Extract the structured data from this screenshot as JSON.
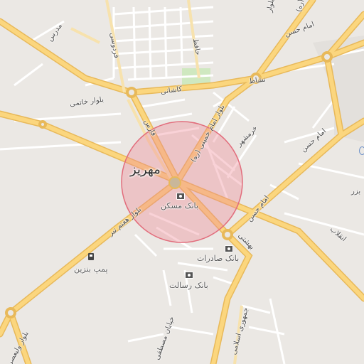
{
  "map": {
    "city_label": "مهریز",
    "roads": {
      "modarres": "مدرس",
      "ferdowsi": "فردوسی",
      "hafez": "حافظ",
      "blvd_khatami": "بلوار خاتمی",
      "kashani": "کاشانی",
      "nashat": "نشاط",
      "blvd_imam_khomeini": "بلوار امام خمینی (ره)",
      "fars": "فارس",
      "imam_hasan_top": "امام حسن",
      "imam_hasan_right": "امام حسن",
      "imam_hasan_mid": "امام حسن",
      "khorramshahr": "خرمشهر",
      "enghelab": "انقلاب",
      "blvd_haftom_tir": "بلوار هفتم تیر",
      "beheshti": "بهشتی",
      "blvd_valiasr": "بلوار ولیعصر",
      "khiaban_mostafa": "خیابان مصطفی",
      "jomhouri_eslami": "جمهوری اسلامی",
      "top_blvd": "بلوار",
      "top_blvd_ra": "(ره)",
      "edge_right": "بزر"
    },
    "pois": {
      "bank_maskan": "بانک مسکن",
      "bank_saderat": "بانک صادرات",
      "bank_resalat": "بانک رسالت",
      "fuel_pump": "پمپ بنزین"
    },
    "colors": {
      "background": "#ebe8e4",
      "major_road": "#fbd67e",
      "major_road_casing": "#e8b95a",
      "minor_road": "#ffffff",
      "park": "#cfe8c0",
      "highlight_fill": "#f08a96",
      "highlight_stroke": "#e26d7c"
    }
  }
}
